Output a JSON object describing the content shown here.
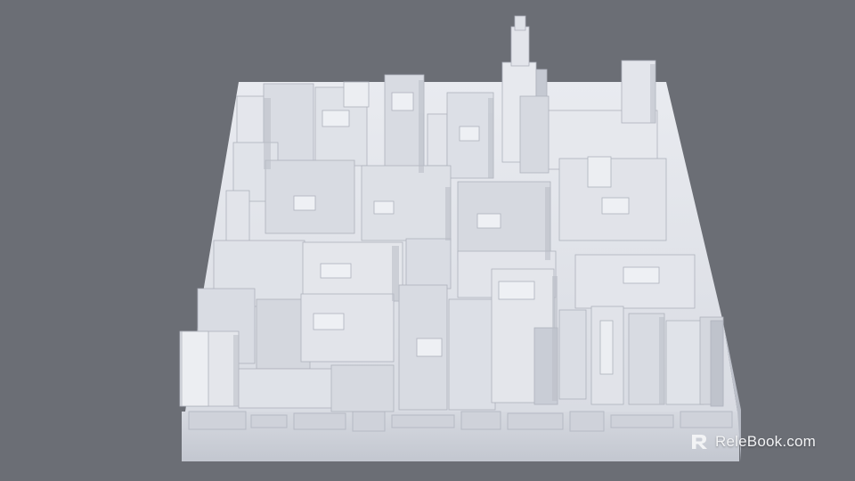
{
  "scene": {
    "subject": "city-block-3d-model",
    "background_color": "#6b6e75",
    "model_color": "#e6e8ee"
  },
  "watermark": {
    "logo_icon": "relebook-r-logo",
    "text": "ReleBook.com"
  }
}
